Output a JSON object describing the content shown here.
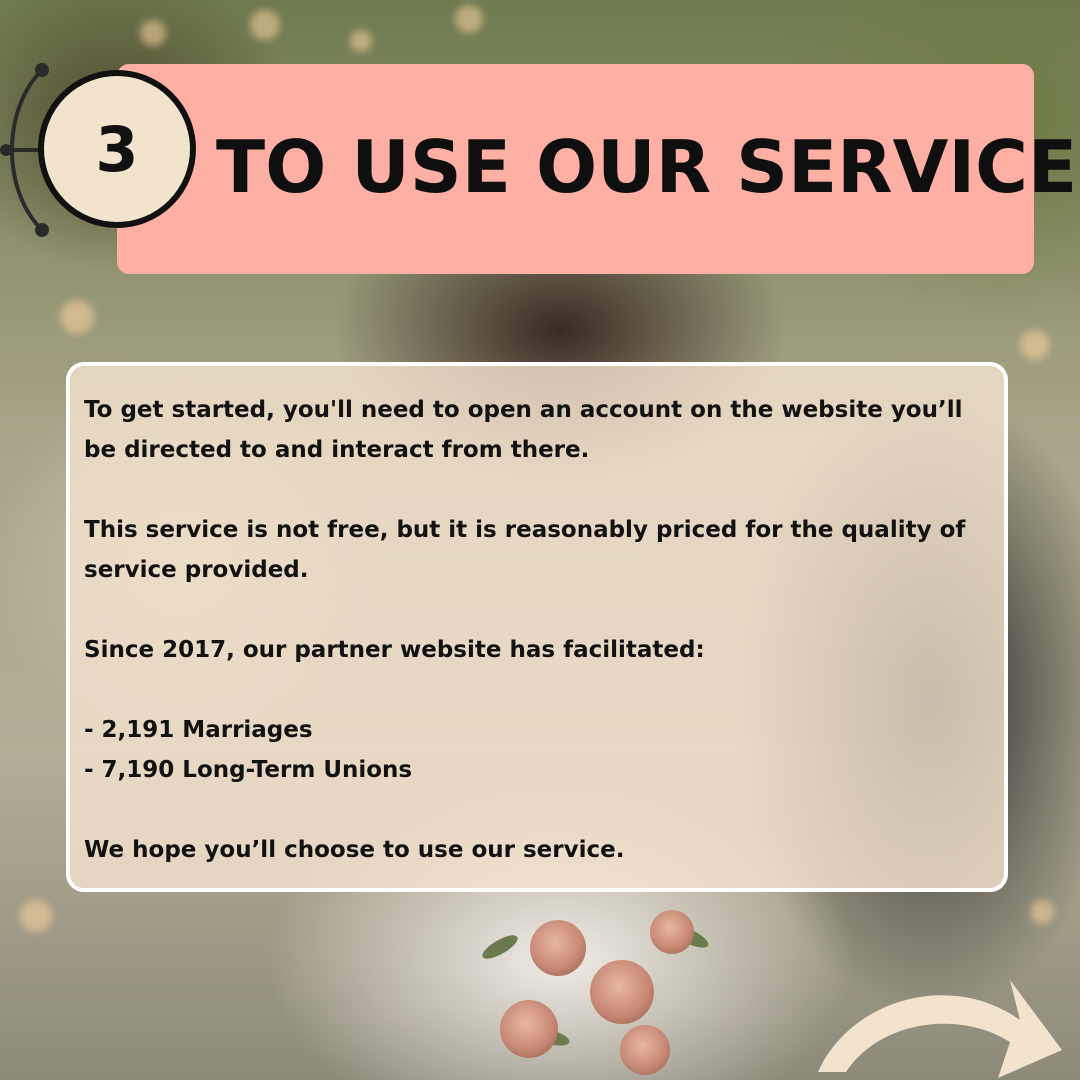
{
  "step": {
    "number": "3",
    "title": "TO USE OUR SERVICE"
  },
  "body": {
    "paragraph_1": "To get started, you'll need to open an account on the website you’ll be directed to and interact from there.",
    "paragraph_2": "This service is not free, but it is reasonably priced for the quality of service provided.",
    "paragraph_3": "Since 2017, our partner website has facilitated:",
    "stats": [
      "- 2,191 Marriages",
      "- 7,190 Long-Term Unions"
    ],
    "closing": "We hope you’ll choose to use our service."
  },
  "colors": {
    "header_bg": "#fdafa3",
    "badge_bg": "#f2e3cd",
    "panel_bg": "#f4e4ce",
    "arrow": "#f2e3cd",
    "text": "#121212"
  },
  "icons": {
    "next": "curved-arrow-right-icon"
  }
}
